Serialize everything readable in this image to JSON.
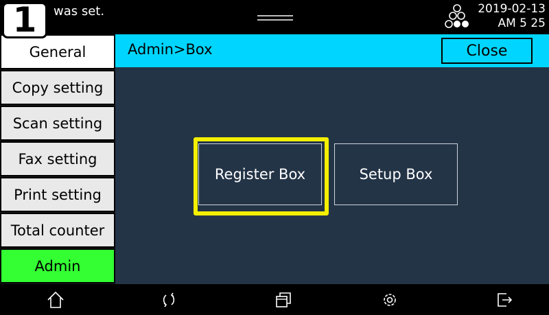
{
  "status_bar": {
    "step_number": "1",
    "message": "was set.",
    "date": "2019-02-13",
    "time": "AM 5  25",
    "icons": [
      "handle-icon",
      "printers-icon"
    ]
  },
  "sidebar": {
    "items": [
      {
        "label": "General",
        "state": "selected"
      },
      {
        "label": "Copy setting",
        "state": "normal"
      },
      {
        "label": "Scan setting",
        "state": "normal"
      },
      {
        "label": "Fax setting",
        "state": "normal"
      },
      {
        "label": "Print setting",
        "state": "normal"
      },
      {
        "label": "Total counter",
        "state": "normal"
      },
      {
        "label": "Admin",
        "state": "active"
      }
    ]
  },
  "header": {
    "title": "Admin>Box",
    "close_label": "Close"
  },
  "main": {
    "buttons": [
      {
        "label": "Register Box",
        "highlighted": true
      },
      {
        "label": "Setup Box",
        "highlighted": false
      }
    ]
  },
  "navbar": {
    "icons": [
      "home-icon",
      "rotate-icon",
      "windows-icon",
      "settings-icon",
      "exit-icon"
    ]
  },
  "colors": {
    "header_accent": "#00d5ff",
    "active_tab": "#33ff33",
    "highlight": "#f4ef00",
    "main_bg": "#243447"
  }
}
